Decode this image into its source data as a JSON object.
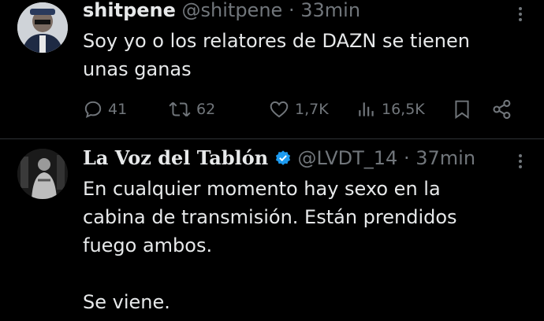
{
  "tweets": [
    {
      "name": "shitpene",
      "handle": "@shitpene",
      "separator": "·",
      "time": "33min",
      "text": "Soy yo o los relatores de DAZN se tienen\nunas ganas",
      "replies": "41",
      "retweets": "62",
      "likes": "1,7K",
      "views": "16,5K"
    },
    {
      "name": "La Voz del Tablón",
      "handle": "@LVDT_14",
      "separator": "·",
      "time": "37min",
      "verified": true,
      "text": "En cualquier momento hay sexo en la\ncabina de transmisión. Están prendidos\nfuego ambos.\n\nSe viene."
    }
  ],
  "colors": {
    "background": "#000000",
    "text": "#e7e9ea",
    "secondary": "#71767b",
    "verified": "#1d9bf0",
    "divider": "#2f3336"
  }
}
